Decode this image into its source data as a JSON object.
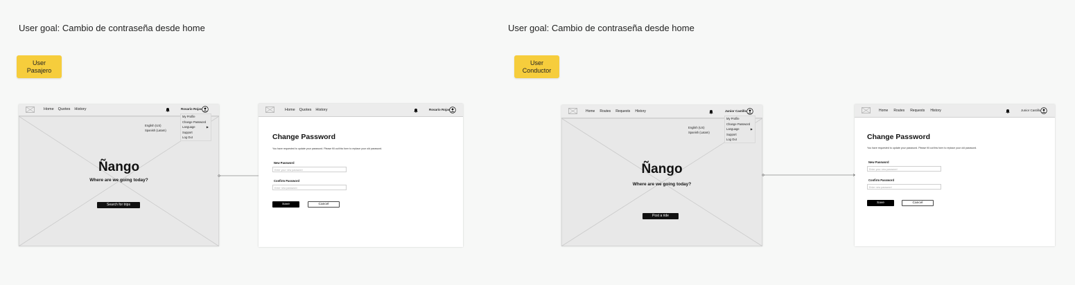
{
  "flows": [
    {
      "goal": "User goal: Cambio de contraseña desde home",
      "role_sticky": "User\nPasajero",
      "home": {
        "nav": [
          "Home",
          "Quotes",
          "History"
        ],
        "user_name": "Rosario Rojas",
        "menu_items": [
          "My Profile",
          "Change Password",
          "Language",
          "Support",
          "Log Out"
        ],
        "languages": [
          "English (US)",
          "Spanish (Latam)"
        ],
        "brand": "Ñango",
        "tagline": "Where are we going today?",
        "cta": "Search for trips"
      },
      "change_password": {
        "nav": [
          "Home",
          "Quotes",
          "History"
        ],
        "user_name": "Rosario Rojas",
        "title": "Change Password",
        "description": "You have requested to update your password. Please fill out this form to replace your old password.",
        "new_password_label": "New Password",
        "new_password_placeholder": "Enter your new password",
        "confirm_password_label": "Confirm Password",
        "confirm_password_placeholder": "Enter new password",
        "save": "Save",
        "cancel": "Cancel"
      }
    },
    {
      "goal": "User goal: Cambio de contraseña desde home",
      "role_sticky": "User\nConductor",
      "home": {
        "nav": [
          "Home",
          "Routes",
          "Requests",
          "History"
        ],
        "user_name": "Junior Castillo",
        "menu_items": [
          "My Profile",
          "Change Password",
          "Language",
          "Support",
          "Log Out"
        ],
        "languages": [
          "English (US)",
          "Spanish (Latam)"
        ],
        "brand": "Ñango",
        "tagline": "Where are we going today?",
        "cta": "Post a ride"
      },
      "change_password": {
        "nav": [
          "Home",
          "Routes",
          "Requests",
          "History"
        ],
        "user_name": "Junior Castillo",
        "title": "Change Password",
        "description": "You have requested to update your password. Please fill out this form to replace your old password.",
        "new_password_label": "New Password",
        "new_password_placeholder": "Enter your new password",
        "confirm_password_label": "Confirm Password",
        "confirm_password_placeholder": "Enter new password",
        "save": "Save",
        "cancel": "Cancel"
      }
    }
  ],
  "colors": {
    "sticky": "#f6cd3c",
    "canvas": "#f7f8f7",
    "placeholder": "#e8e8e8"
  }
}
